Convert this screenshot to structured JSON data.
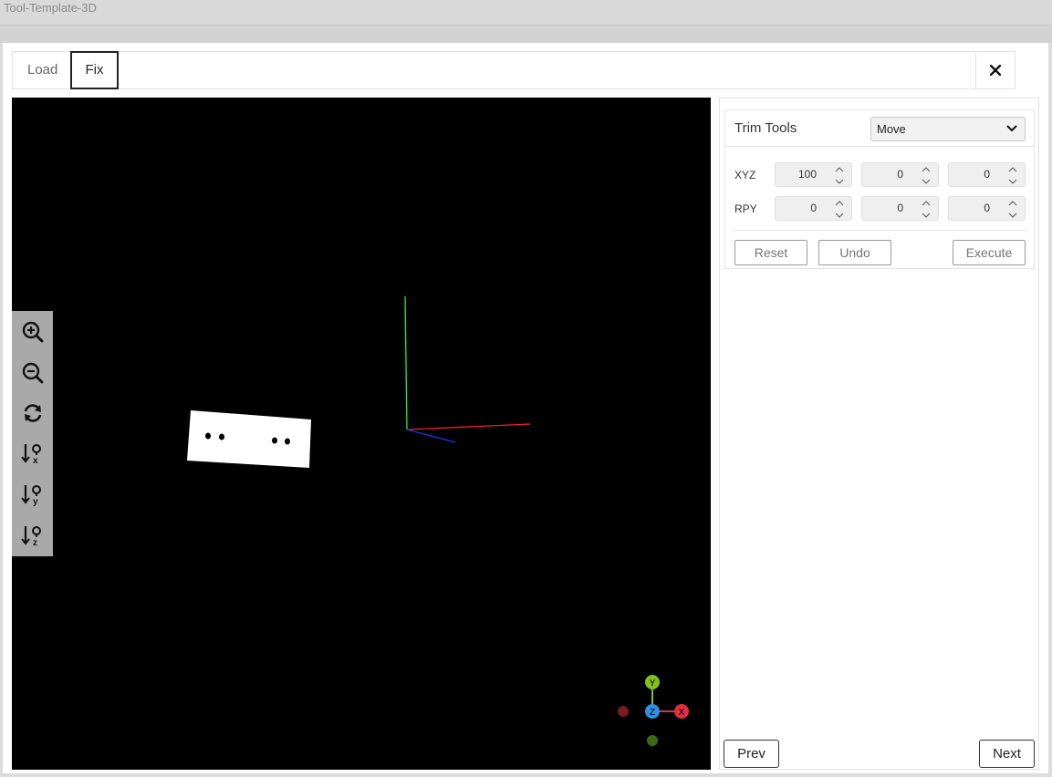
{
  "window": {
    "title": "Tool-Template-3D"
  },
  "tabs": [
    {
      "label": "Load",
      "active": false
    },
    {
      "label": "Fix",
      "active": true
    }
  ],
  "trim_tools": {
    "title": "Trim Tools",
    "mode": "Move",
    "xyz_label": "XYZ",
    "rpy_label": "RPY",
    "xyz": [
      "100",
      "0",
      "0"
    ],
    "rpy": [
      "0",
      "0",
      "0"
    ],
    "reset_label": "Reset",
    "undo_label": "Undo",
    "execute_label": "Execute"
  },
  "gizmo": {
    "y": "Y",
    "z": "Z",
    "x": "X"
  },
  "nav": {
    "prev": "Prev",
    "next": "Next"
  },
  "icons": {
    "close": "close-icon",
    "viewer_tools": [
      "zoom-in-icon",
      "zoom-out-icon",
      "refresh-icon",
      "view-x-icon",
      "view-y-icon",
      "view-z-icon"
    ]
  },
  "colors": {
    "axis_x": "#e03040",
    "axis_y": "#80c020",
    "axis_z": "#3090e0"
  }
}
